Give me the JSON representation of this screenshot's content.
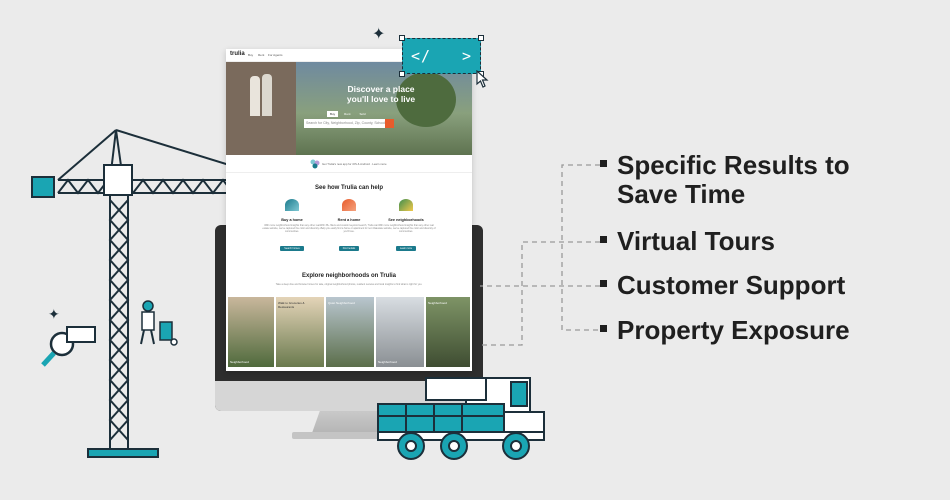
{
  "site": {
    "logo": "trulia",
    "nav": [
      "Buy",
      "Rent",
      "For Agents"
    ],
    "nav_right": "Create Account",
    "hero": {
      "title_line1": "Discover a place",
      "title_line2": "you'll love to live",
      "tabs": [
        "Buy",
        "Rent",
        "Sold"
      ],
      "search_placeholder": "Search for City, Neighborhood, Zip, County, School"
    },
    "notice": "Get Trulia's new app for iOS & Android  ·  Learn more",
    "help": {
      "title": "See how Trulia can help",
      "cards": [
        {
          "name": "Buy a home",
          "desc": "With more neighborhood insights than any other real estate website, we've captured the color and diversity of communities.",
          "button": "Search homes"
        },
        {
          "name": "Rent a home",
          "desc": "With 35+ filters and custom keyword search, Trulia can help you easily find a home or apartment for rent that you'll love.",
          "button": "Find rentals"
        },
        {
          "name": "See neighborhoods",
          "desc": "With more neighborhood insights than any other real estate website, we've captured the color and diversity of communities.",
          "button": "Learn more"
        }
      ]
    },
    "explore": {
      "title": "Explore neighborhoods on Trulia",
      "subtitle": "Take a deep dive and browse homes for sale, original neighborhood photos, resident reviews and local insights to find what is right for you."
    },
    "photos": [
      {
        "caption": "Neighborhood"
      },
      {
        "caption": "Walk to Groceries & Restaurants"
      },
      {
        "caption": "Quiet Neighborhood"
      },
      {
        "caption": "Neighborhood"
      },
      {
        "caption": "Neighborhood"
      }
    ]
  },
  "features": [
    {
      "line1": "Specific Results to",
      "line2": "Save Time"
    },
    {
      "line1": "Virtual Tours",
      "line2": ""
    },
    {
      "line1": "Customer Support",
      "line2": ""
    },
    {
      "line1": "Property Exposure",
      "line2": ""
    }
  ],
  "code_tag": {
    "left": "</",
    "right": ">"
  },
  "colors": {
    "teal": "#1aa5b3",
    "dark": "#1c2f3a",
    "background": "#ebebeb",
    "accent_orange": "#e85c2c"
  }
}
